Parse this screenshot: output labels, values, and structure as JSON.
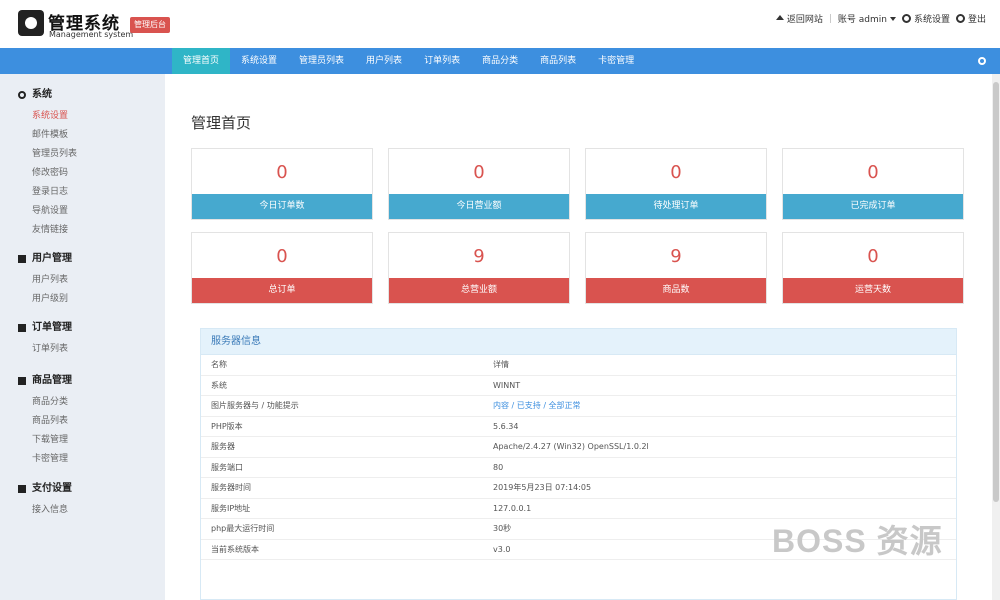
{
  "header": {
    "logo_title": "管理系统",
    "logo_sub": "Management system",
    "badge": "管理后台",
    "nav": {
      "home": "返回网站",
      "account": "账号 admin",
      "settings": "系统设置",
      "logout": "登出"
    }
  },
  "topnav": {
    "tabs": [
      "管理首页",
      "系统设置",
      "管理员列表",
      "用户列表",
      "订单列表",
      "商品分类",
      "商品列表",
      "卡密管理"
    ],
    "active_index": 0
  },
  "sidebar": {
    "groups": [
      {
        "title": "系统",
        "icon": "gear-icon",
        "items": [
          "系统设置",
          "邮件模板",
          "管理员列表",
          "修改密码",
          "登录日志",
          "导航设置",
          "友情链接"
        ]
      },
      {
        "title": "用户管理",
        "icon": "user-icon",
        "items": [
          "用户列表",
          "用户级别"
        ]
      },
      {
        "title": "订单管理",
        "icon": "list-icon",
        "items": [
          "订单列表"
        ]
      },
      {
        "title": "商品管理",
        "icon": "cart-icon",
        "items": [
          "商品分类",
          "商品列表",
          "下载管理",
          "卡密管理"
        ]
      },
      {
        "title": "支付设置",
        "icon": "card-icon",
        "items": [
          "接入信息"
        ]
      }
    ],
    "active_item": "系统设置"
  },
  "main": {
    "title": "管理首页",
    "stats": [
      {
        "value": "0",
        "label": "今日订单数"
      },
      {
        "value": "0",
        "label": "今日营业额"
      },
      {
        "value": "0",
        "label": "待处理订单"
      },
      {
        "value": "0",
        "label": "已完成订单"
      },
      {
        "value": "0",
        "label": "总订单"
      },
      {
        "value": "9",
        "label": "总营业额"
      },
      {
        "value": "9",
        "label": "商品数"
      },
      {
        "value": "0",
        "label": "运营天数"
      }
    ],
    "server": {
      "title": "服务器信息",
      "rows": [
        {
          "k": "名称",
          "v": "详情"
        },
        {
          "k": "系统",
          "v": "WINNT"
        },
        {
          "k": "图片服务器与 / 功能提示",
          "v": "内容 / 已支持 / 全部正常"
        },
        {
          "k": "PHP版本",
          "v": "5.6.34"
        },
        {
          "k": "服务器",
          "v": "Apache/2.4.27 (Win32) OpenSSL/1.0.2l"
        },
        {
          "k": "服务端口",
          "v": "80"
        },
        {
          "k": "服务器时间",
          "v": "2019年5月23日 07:14:05"
        },
        {
          "k": "服务IP地址",
          "v": "127.0.0.1"
        },
        {
          "k": "php最大运行时间",
          "v": "30秒"
        },
        {
          "k": "当前系统版本",
          "v": "v3.0"
        }
      ]
    }
  },
  "watermark": "BOSS 资源"
}
